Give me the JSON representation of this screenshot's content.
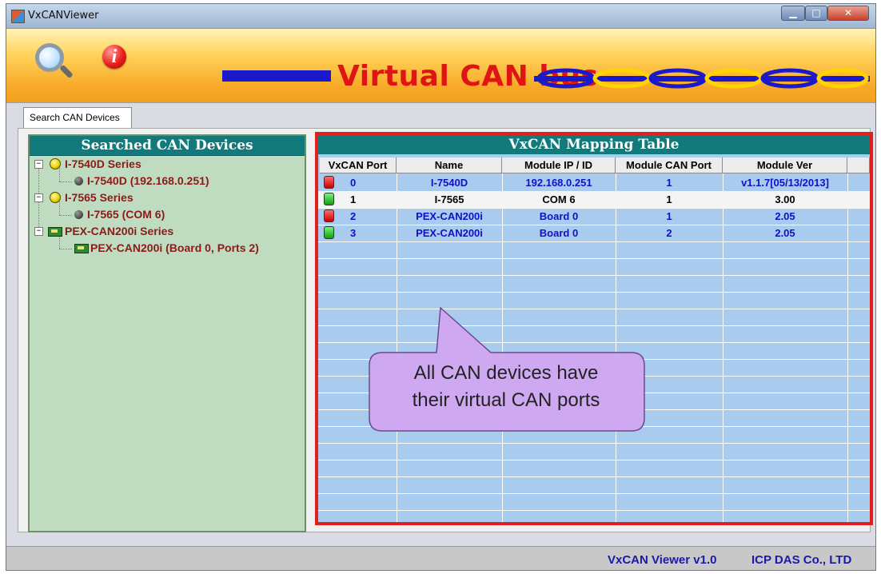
{
  "window": {
    "title": "VxCANViewer",
    "min_glyph": "▁",
    "max_glyph": "□",
    "close_glyph": "✕"
  },
  "toolbar": {
    "search_icon": "magnifier-icon",
    "info_icon": "info-icon",
    "info_glyph": "i"
  },
  "banner": {
    "title": "Virtual CAN bus"
  },
  "tabs": [
    {
      "label": "Search CAN Devices"
    }
  ],
  "tree": {
    "header": "Searched CAN Devices",
    "nodes": [
      {
        "label": "I-7540D Series",
        "children": [
          "I-7540D (192.168.0.251)"
        ]
      },
      {
        "label": "I-7565 Series",
        "children": [
          "I-7565 (COM 6)"
        ]
      },
      {
        "label": "PEX-CAN200i Series",
        "children": [
          "PEX-CAN200i (Board 0, Ports 2)"
        ]
      }
    ]
  },
  "mapping_table": {
    "header": "VxCAN Mapping Table",
    "columns": [
      "VxCAN Port",
      "Name",
      "Module IP / ID",
      "Module CAN Port",
      "Module Ver"
    ],
    "rows": [
      {
        "port": "0",
        "name": "I-7540D",
        "ip": "192.168.0.251",
        "can_port": "1",
        "ver": "v1.1.7[05/13/2013]",
        "status": "red"
      },
      {
        "port": "1",
        "name": "I-7565",
        "ip": "COM 6",
        "can_port": "1",
        "ver": "3.00",
        "status": "green"
      },
      {
        "port": "2",
        "name": "PEX-CAN200i",
        "ip": "Board 0",
        "can_port": "1",
        "ver": "2.05",
        "status": "red"
      },
      {
        "port": "3",
        "name": "PEX-CAN200i",
        "ip": "Board 0",
        "can_port": "2",
        "ver": "2.05",
        "status": "green"
      }
    ]
  },
  "callout": {
    "line1": "All CAN devices have",
    "line2": "their virtual CAN ports"
  },
  "status_bar": {
    "version": "VxCAN Viewer v1.0",
    "company": "ICP DAS Co., LTD"
  },
  "colors": {
    "accent_red": "#e21f1f",
    "header_teal": "#127a7a",
    "tree_bg": "#c0dcc0",
    "table_bg": "#a9cbee",
    "text_blue": "#1010c8"
  }
}
